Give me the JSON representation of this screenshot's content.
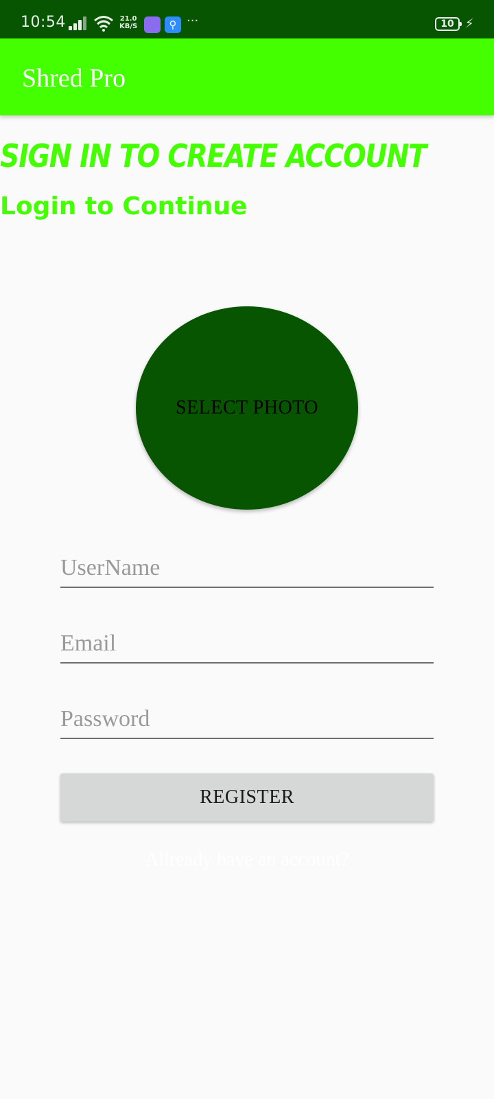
{
  "status_bar": {
    "time": "10:54",
    "net_speed_value": "21.0",
    "net_speed_unit": "KB/S",
    "more": "···",
    "battery": "10",
    "icons": [
      "signal-icon",
      "wifi-icon",
      "app-notification-icon",
      "usb-icon",
      "charging-icon"
    ]
  },
  "app_bar": {
    "title": "Shred Pro"
  },
  "heading": {
    "main": "Sign In to Create Account",
    "sub": "Login to Continue"
  },
  "photo": {
    "label": "SELECT PHOTO"
  },
  "form": {
    "username_placeholder": "UserName",
    "email_placeholder": "Email",
    "password_placeholder": "Password",
    "username_value": "",
    "email_value": "",
    "password_value": ""
  },
  "register_label": "REGISTER",
  "login_link": "Allready have an account?",
  "colors": {
    "accent": "#44ff00",
    "dark_green": "#075500",
    "background": "#fafafa",
    "button_gray": "#d6d7d7"
  }
}
